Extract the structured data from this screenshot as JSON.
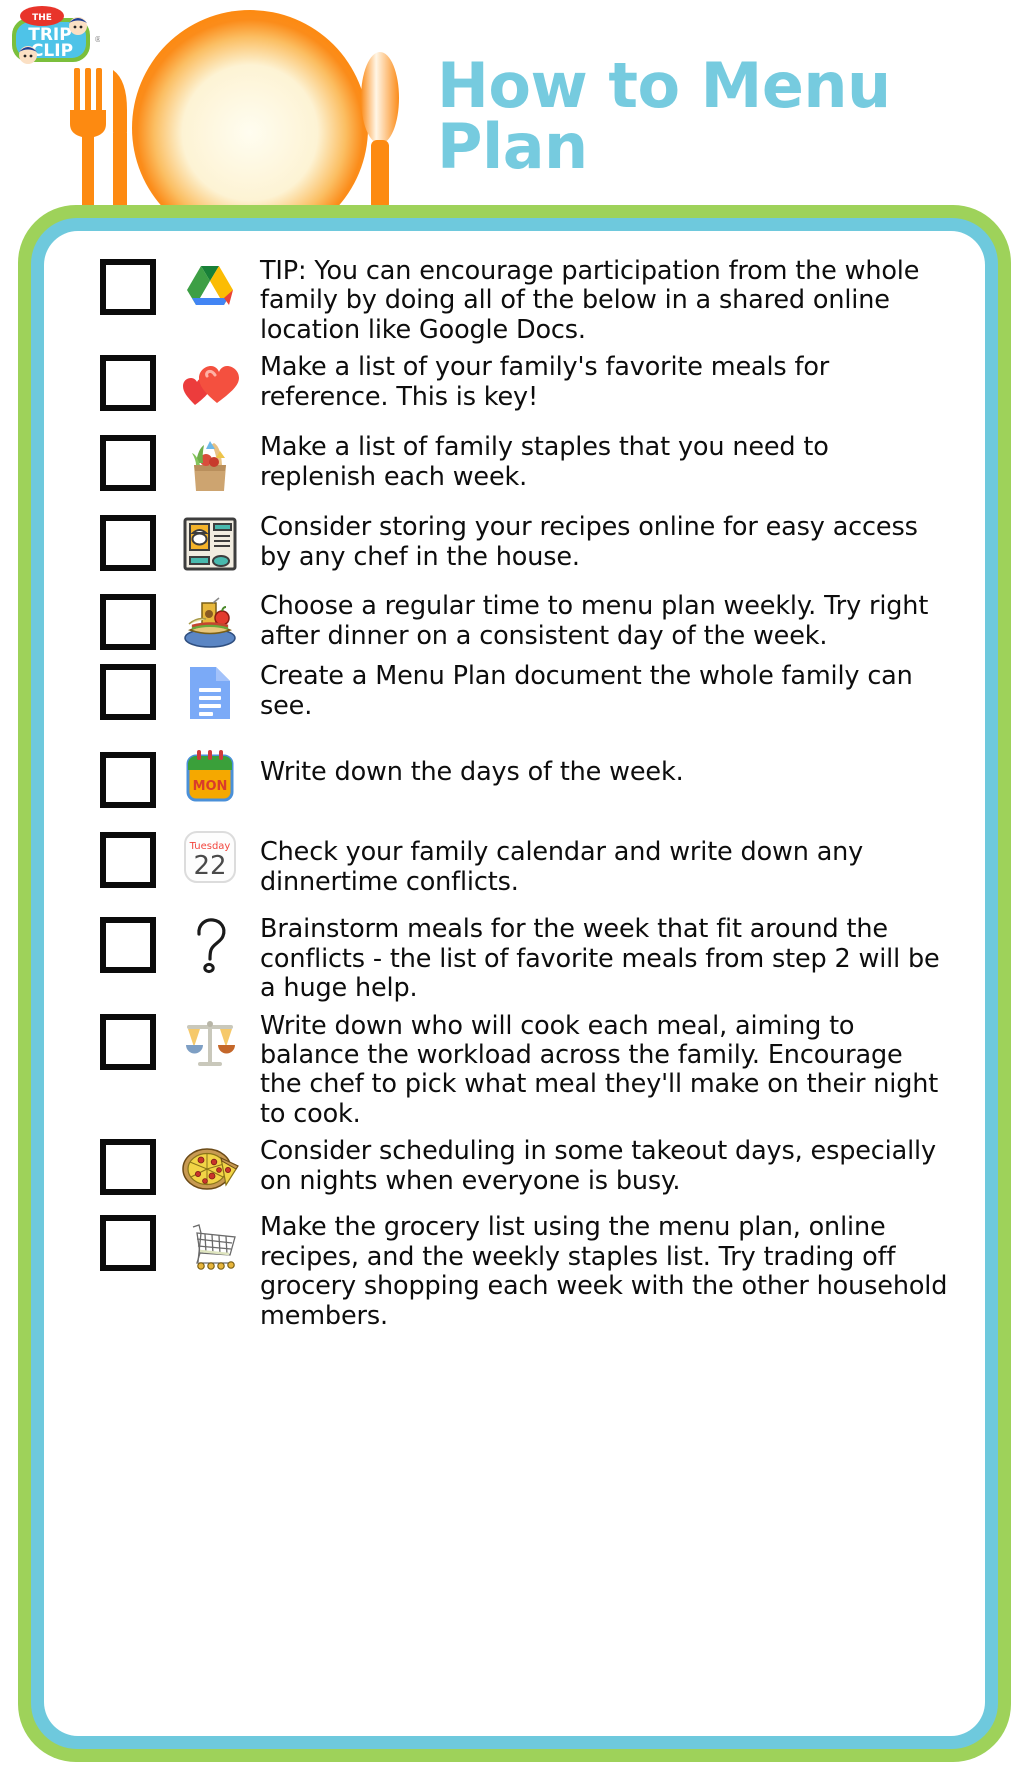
{
  "brand": {
    "logo_the": "THE",
    "logo_line1": "TRIP",
    "logo_line2": "CLIP",
    "logo_registered": "®",
    "logo_name": "trip-clip-logo"
  },
  "header": {
    "title": "How to Menu Plan",
    "title_color": "#76cbdf",
    "decoration": "place-setting-fork-knife-plate-spoon"
  },
  "frame": {
    "outer_color": "#9ed25a",
    "inner_color": "#6ec9dd",
    "card_color": "#ffffff"
  },
  "checklist": {
    "items": [
      {
        "icon": "google-drive-icon",
        "text": "TIP: You can encourage participation from the whole family by doing all of the below in a shared online location like Google Docs.",
        "checked": false
      },
      {
        "icon": "two-hearts-icon",
        "text": "Make a list of your family's favorite meals for reference. This is key!",
        "checked": false
      },
      {
        "icon": "grocery-bag-icon",
        "text": "Make a list of family staples that you need to replenish each week.",
        "checked": false
      },
      {
        "icon": "recipe-card-icon",
        "text": "Consider storing your recipes online for easy access by any chef in the house.",
        "checked": false
      },
      {
        "icon": "lunch-tray-icon",
        "text": "Choose a regular time to menu plan weekly. Try right after dinner on a consistent day of the week.",
        "checked": false
      },
      {
        "icon": "google-docs-icon",
        "text": "Create a Menu Plan document the whole family can see.",
        "checked": false
      },
      {
        "icon": "calendar-mon-icon",
        "text": "Write down the days of the week.",
        "checked": false,
        "icon_label_top": "",
        "icon_label_main": "MON"
      },
      {
        "icon": "calendar-date-icon",
        "text": "Check your family calendar and write down any dinnertime conflicts.",
        "checked": false,
        "icon_label_top": "Tuesday",
        "icon_label_main": "22"
      },
      {
        "icon": "question-mark-icon",
        "text": "Brainstorm meals for the week that fit around the conflicts - the list of favorite meals from step 2 will be a huge help.",
        "checked": false
      },
      {
        "icon": "balance-scale-icon",
        "text": "Write down who will cook each meal, aiming to balance the workload across the family. Encourage the chef to pick what meal they'll make on their night to cook.",
        "checked": false
      },
      {
        "icon": "pizza-icon",
        "text": "Consider scheduling in some takeout days, especially on nights when everyone is busy.",
        "checked": false
      },
      {
        "icon": "shopping-cart-icon",
        "text": "Make the grocery list using the menu plan, online recipes, and the weekly staples list. Try trading off grocery shopping each week with the other household members.",
        "checked": false
      }
    ]
  }
}
